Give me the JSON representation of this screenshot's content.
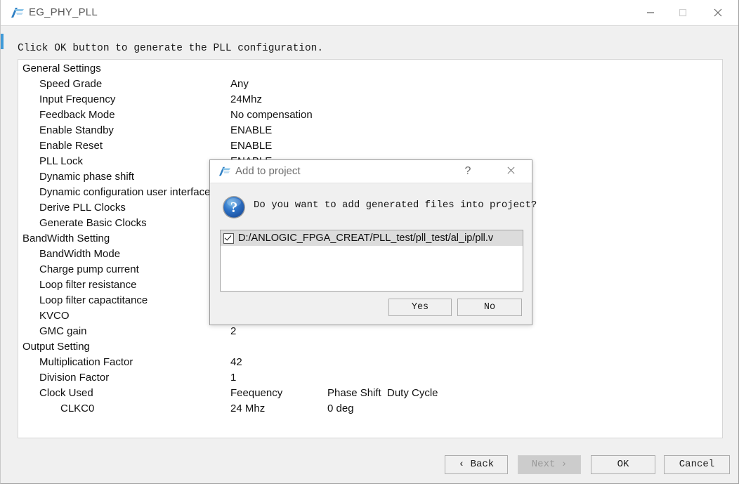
{
  "window": {
    "title": "EG_PHY_PLL",
    "icon": "anlogic-logo-icon",
    "minimize_label": "minimize-icon",
    "maximize_label": "maximize-icon",
    "close_label": "close-icon"
  },
  "instruction": "Click OK button to generate the PLL configuration.",
  "summary": {
    "rows": [
      {
        "level": 0,
        "label": "General Settings",
        "value": ""
      },
      {
        "level": 1,
        "label": "Speed Grade",
        "value": "Any"
      },
      {
        "level": 1,
        "label": "Input Frequency",
        "value": "24Mhz"
      },
      {
        "level": 1,
        "label": "Feedback Mode",
        "value": "No compensation"
      },
      {
        "level": 1,
        "label": "Enable Standby",
        "value": "ENABLE"
      },
      {
        "level": 1,
        "label": "Enable Reset",
        "value": "ENABLE"
      },
      {
        "level": 1,
        "label": "PLL Lock",
        "value": "ENABLE"
      },
      {
        "level": 1,
        "label": "Dynamic phase shift",
        "value": ""
      },
      {
        "level": 1,
        "label": "Dynamic configuration user interface",
        "value": ""
      },
      {
        "level": 1,
        "label": "Derive PLL Clocks",
        "value": ""
      },
      {
        "level": 1,
        "label": "Generate Basic Clocks",
        "value": ""
      },
      {
        "level": 0,
        "label": "BandWidth Setting",
        "value": ""
      },
      {
        "level": 1,
        "label": "BandWidth Mode",
        "value": ""
      },
      {
        "level": 1,
        "label": "Charge pump current",
        "value": ""
      },
      {
        "level": 1,
        "label": "Loop filter resistance",
        "value": ""
      },
      {
        "level": 1,
        "label": "Loop filter capactitance",
        "value": ""
      },
      {
        "level": 1,
        "label": "KVCO",
        "value": ""
      },
      {
        "level": 1,
        "label": "GMC gain",
        "value": "2"
      },
      {
        "level": 0,
        "label": "Output Setting",
        "value": ""
      },
      {
        "level": 1,
        "label": "Multiplication Factor",
        "value": "42"
      },
      {
        "level": 1,
        "label": "Division Factor",
        "value": "1"
      },
      {
        "level": 1,
        "label": "Clock Used",
        "value": "Feequency",
        "value2": "Phase Shift",
        "value3": "Duty Cycle"
      },
      {
        "level": 2,
        "label": "CLKC0",
        "value": "24 Mhz",
        "value2": "0 deg",
        "value3": ""
      }
    ]
  },
  "wizard_buttons": {
    "back": "‹  Back",
    "next": "Next  ›",
    "ok": "OK",
    "cancel": "Cancel"
  },
  "modal": {
    "title": "Add to project",
    "icon": "anlogic-logo-icon",
    "help_label": "?",
    "close_label": "close-icon",
    "question_icon": "question-mark-icon",
    "message": "Do you want to add generated files into project?",
    "file_list": [
      {
        "checked": true,
        "path": "D:/ANLOGIC_FPGA_CREAT/PLL_test/pll_test/al_ip/pll.v"
      }
    ],
    "yes_label": "Yes",
    "no_label": "No"
  },
  "colors": {
    "accent_blue": "#3f9ad8",
    "window_bg": "#f0f0f0",
    "panel_bg": "#ffffff",
    "text": "#111111",
    "disabled_text": "#9a9a9a"
  }
}
